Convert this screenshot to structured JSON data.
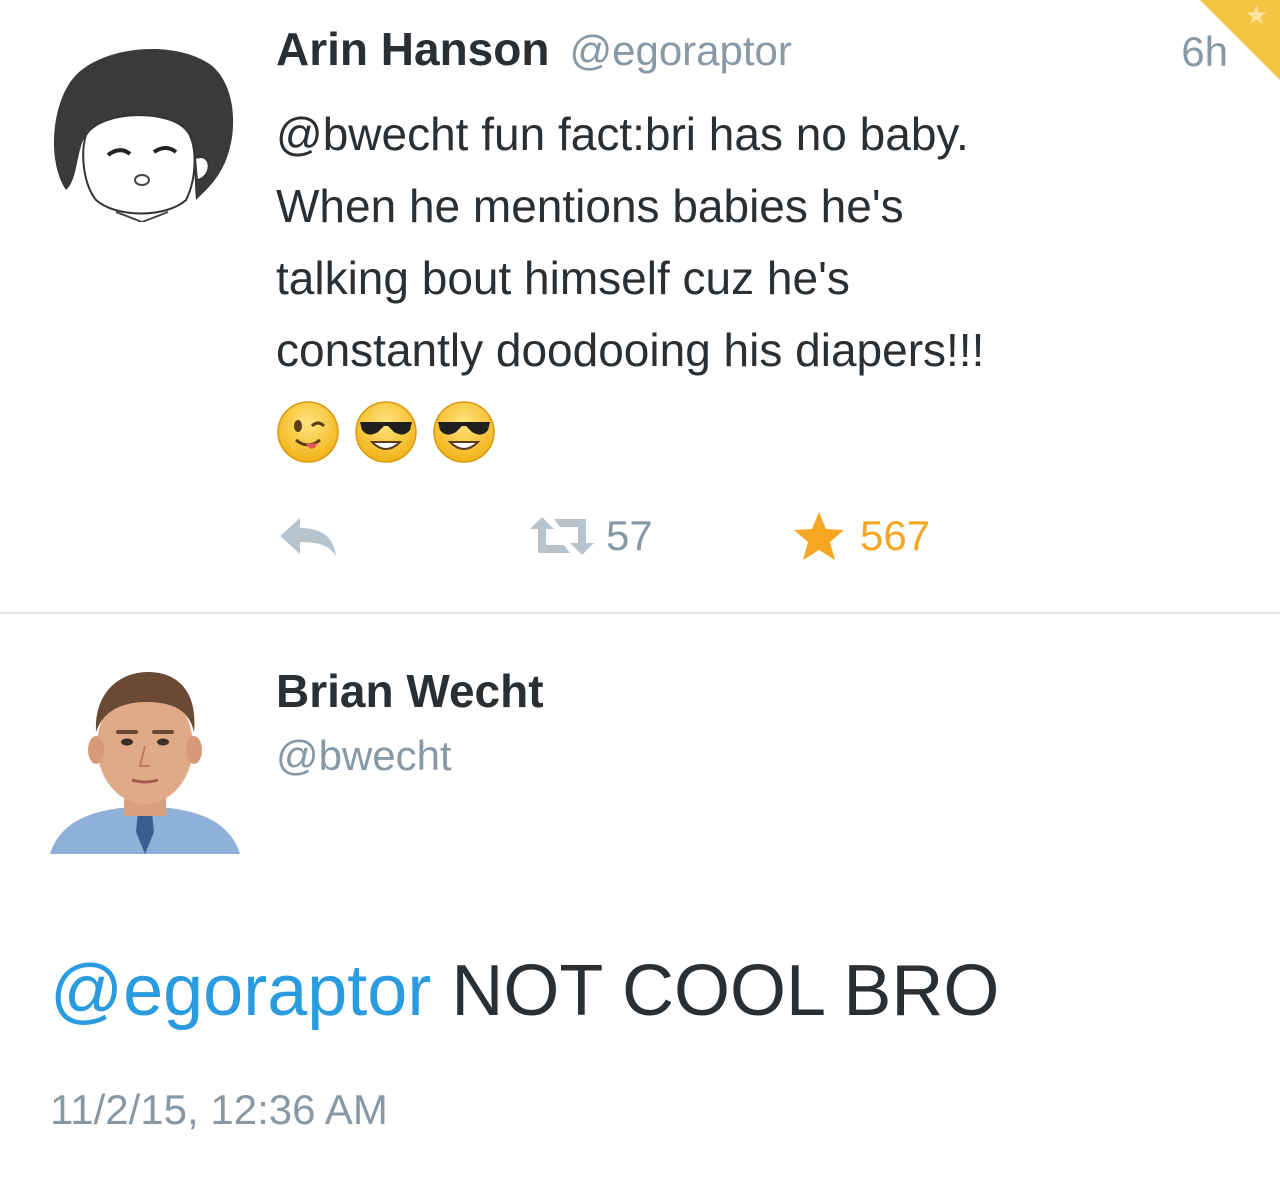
{
  "tweet1": {
    "name": "Arin Hanson",
    "handle": "@egoraptor",
    "time": "6h",
    "lines": [
      "@bwecht fun fact:bri has no baby.",
      "When he mentions babies he's",
      "talking bout himself cuz he's",
      "constantly doodooing his diapers!!!"
    ],
    "emojis": [
      "winking-face-tongue-emoji",
      "sunglasses-emoji",
      "sunglasses-emoji"
    ],
    "retweet_count": "57",
    "favorite_count": "567"
  },
  "tweet2": {
    "name": "Brian Wecht",
    "handle": "@bwecht",
    "mention": "@egoraptor",
    "text": " NOT COOL BRO",
    "date": "11/2/15, 12:36 AM"
  },
  "colors": {
    "link": "#2b9be0",
    "muted": "#8899a6",
    "favorite": "#f5a623",
    "text": "#292f33",
    "divider": "#e1e8ed"
  }
}
